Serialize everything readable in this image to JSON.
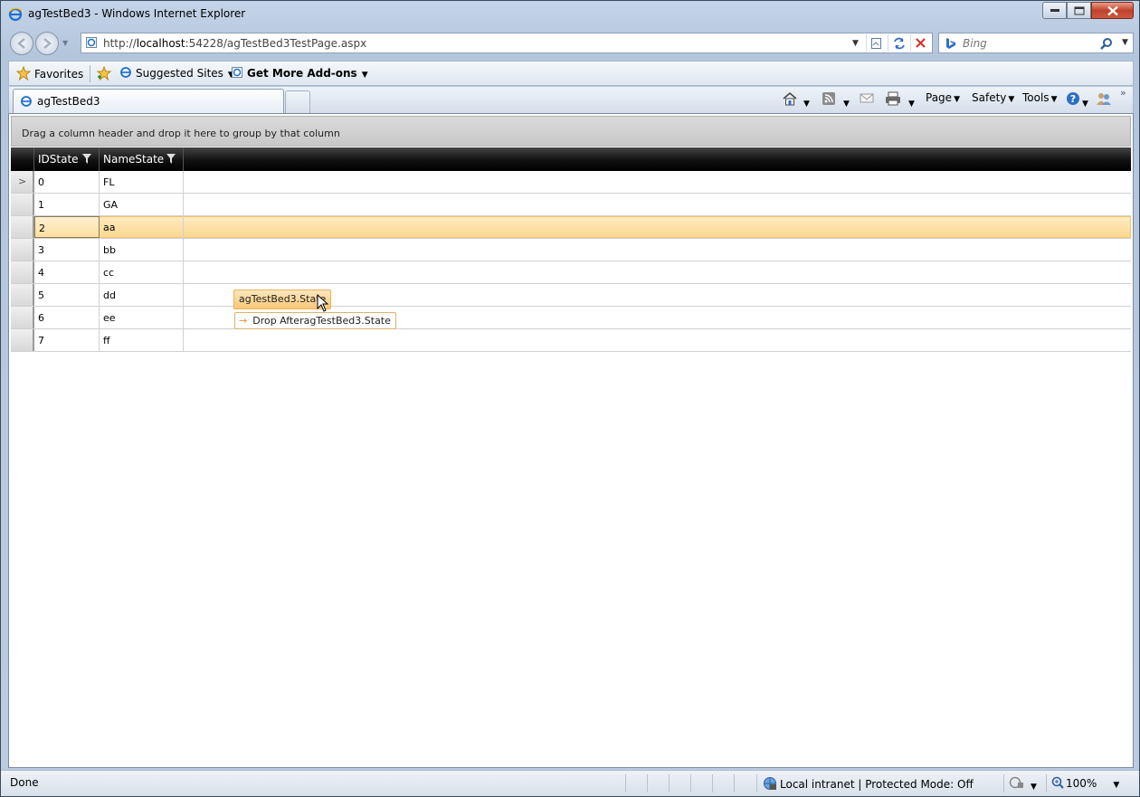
{
  "window": {
    "title": "agTestBed3 - Windows Internet Explorer"
  },
  "nav": {
    "url_prefix": "http://",
    "url_host": "localhost",
    "url_rest": ":54228/agTestBed3TestPage.aspx",
    "search_placeholder": "Bing"
  },
  "favorites_bar": {
    "favorites_label": "Favorites",
    "suggested_sites_label": "Suggested Sites",
    "addons_label": "Get More Add-ons"
  },
  "tabs": [
    {
      "label": "agTestBed3"
    }
  ],
  "command_bar": {
    "page_label": "Page",
    "safety_label": "Safety",
    "tools_label": "Tools"
  },
  "grid": {
    "group_hint": "Drag a column header and drop it here to group by that column",
    "columns": [
      "IDState",
      "NameState"
    ],
    "rows": [
      {
        "id": "0",
        "name": "FL"
      },
      {
        "id": "1",
        "name": "GA"
      },
      {
        "id": "2",
        "name": "aa"
      },
      {
        "id": "3",
        "name": "bb"
      },
      {
        "id": "4",
        "name": "cc"
      },
      {
        "id": "5",
        "name": "dd"
      },
      {
        "id": "6",
        "name": "ee"
      },
      {
        "id": "7",
        "name": "ff"
      }
    ],
    "current_row": "0",
    "selected_row": "2"
  },
  "drag": {
    "item_label": "agTestBed3.State",
    "drop_hint": "Drop AfteragTestBed3.State"
  },
  "status": {
    "text": "Done",
    "zone": "Local intranet | Protected Mode: Off",
    "zoom": "100%"
  },
  "colors": {
    "selected_row": "#fde4b0",
    "header_bg": "#000000",
    "drag_tip": "#f8c878"
  },
  "icons": {
    "app": "ie-logo-icon",
    "back": "back-arrow-icon",
    "forward": "forward-arrow-icon",
    "home": "home-icon",
    "feeds": "rss-icon",
    "mail": "mail-icon",
    "print": "printer-icon",
    "help": "help-icon",
    "filter": "filter-icon",
    "search": "search-icon"
  }
}
